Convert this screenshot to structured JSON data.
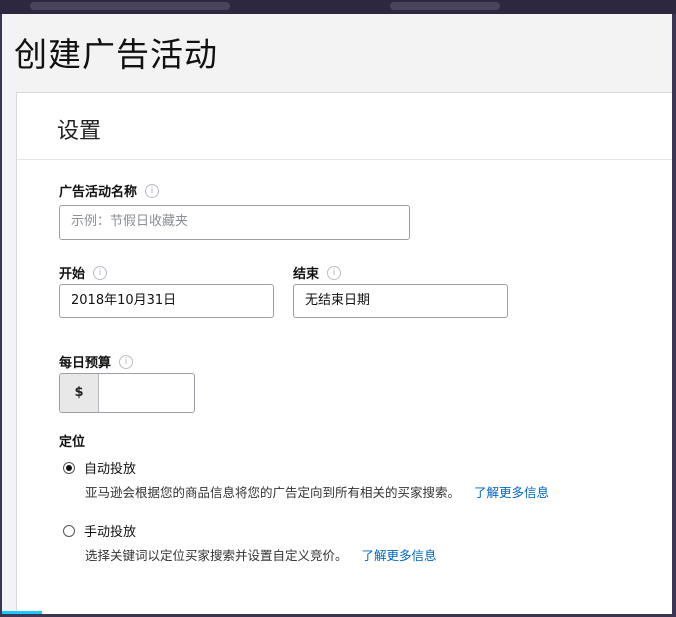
{
  "page": {
    "title": "创建广告活动"
  },
  "settings": {
    "section_title": "设置",
    "campaign_name": {
      "label": "广告活动名称",
      "placeholder": "示例：节假日收藏夹",
      "value": ""
    },
    "start": {
      "label": "开始",
      "value": "2018年10月31日"
    },
    "end": {
      "label": "结束",
      "value": "无结束日期"
    },
    "daily_budget": {
      "label": "每日预算",
      "currency": "$",
      "value": ""
    },
    "targeting": {
      "label": "定位",
      "options": [
        {
          "label": "自动投放",
          "selected": true,
          "description": "亚马逊会根据您的商品信息将您的广告定向到所有相关的买家搜索。",
          "link": "了解更多信息"
        },
        {
          "label": "手动投放",
          "selected": false,
          "description": "选择关键词以定位买家搜索并设置自定义竞价。",
          "link": "了解更多信息"
        }
      ]
    }
  },
  "colors": {
    "link": "#0066c0",
    "border": "#9aa0a6",
    "page_bg": "#f3f3f3",
    "frame": "#3c3553"
  }
}
